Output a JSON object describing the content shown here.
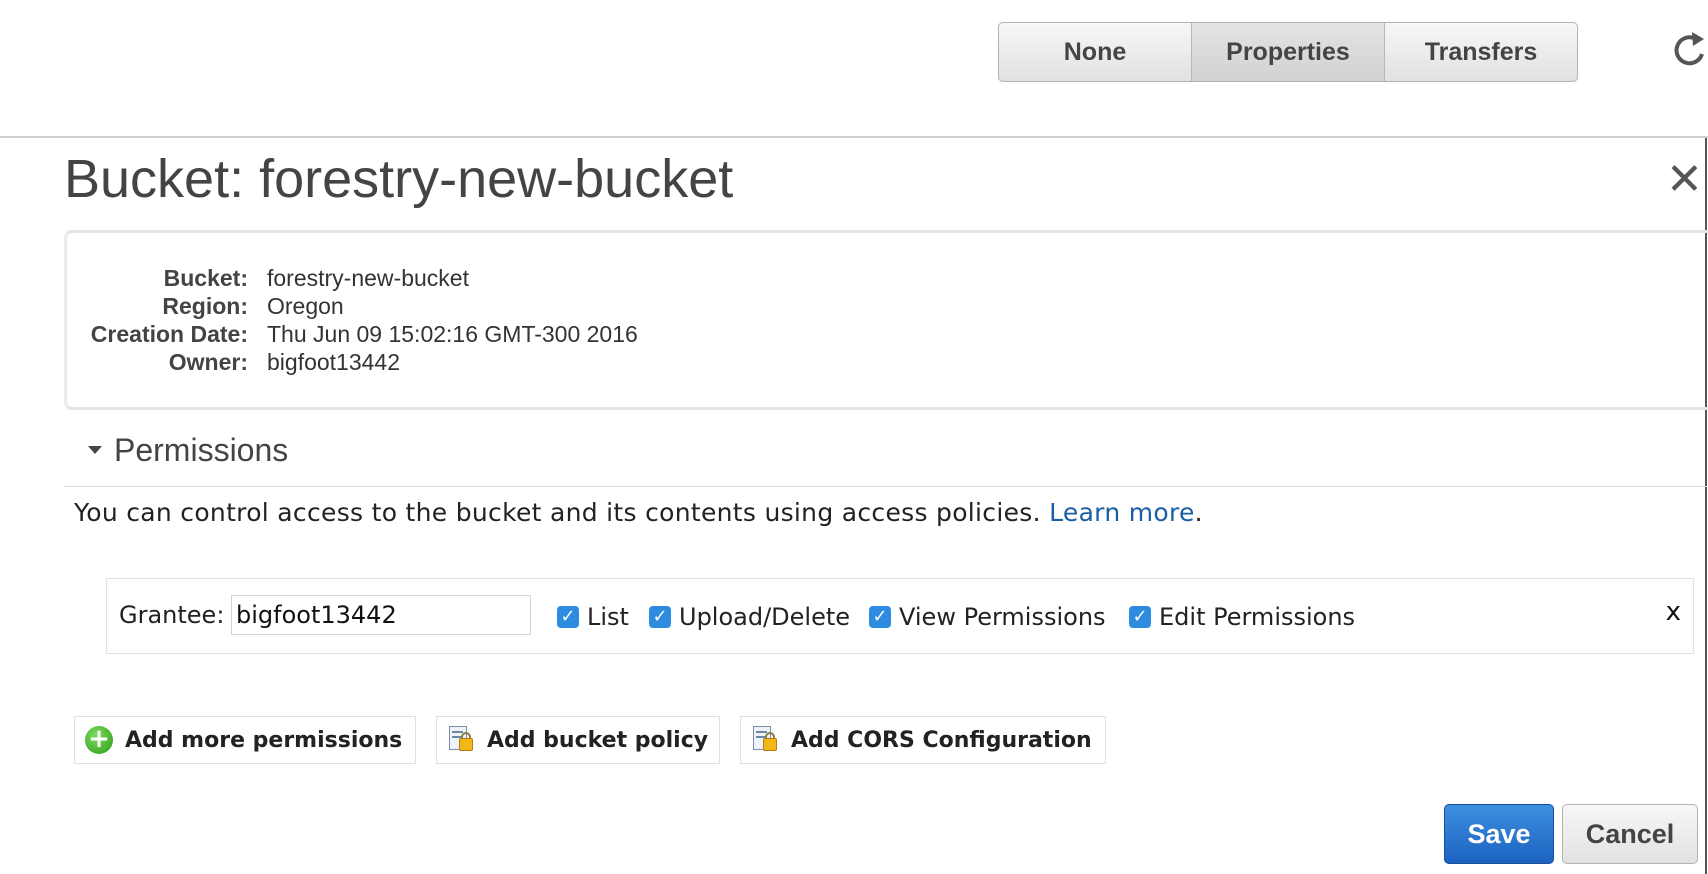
{
  "toolbar": {
    "tabs": [
      {
        "label": "None",
        "active": false
      },
      {
        "label": "Properties",
        "active": true
      },
      {
        "label": "Transfers",
        "active": false
      }
    ],
    "refresh_icon": "refresh-icon"
  },
  "panel": {
    "title": "Bucket: forestry-new-bucket",
    "close_label": "✕"
  },
  "info": {
    "rows": [
      {
        "key": "Bucket:",
        "value": "forestry-new-bucket"
      },
      {
        "key": "Region:",
        "value": "Oregon"
      },
      {
        "key": "Creation Date:",
        "value": "Thu Jun 09 15:02:16 GMT-300 2016"
      },
      {
        "key": "Owner:",
        "value": "bigfoot13442"
      }
    ]
  },
  "permissions": {
    "header": "Permissions",
    "intro_text": "You can control access to the bucket and its contents using access policies.",
    "learn_more": "Learn more",
    "intro_end": ".",
    "grant": {
      "grantee_label": "Grantee:",
      "grantee_value": "bigfoot13442",
      "options": [
        {
          "label": "List",
          "checked": true
        },
        {
          "label": "Upload/Delete",
          "checked": true
        },
        {
          "label": "View Permissions",
          "checked": true
        },
        {
          "label": "Edit Permissions",
          "checked": true
        }
      ],
      "remove_label": "x"
    }
  },
  "actions": {
    "add_permissions": "Add more permissions",
    "add_bucket_policy": "Add bucket policy",
    "add_cors": "Add CORS Configuration"
  },
  "footer": {
    "save": "Save",
    "cancel": "Cancel"
  },
  "colors": {
    "accent": "#1c63c0",
    "link": "#1a5fa4",
    "checkbox": "#2d8be0"
  }
}
